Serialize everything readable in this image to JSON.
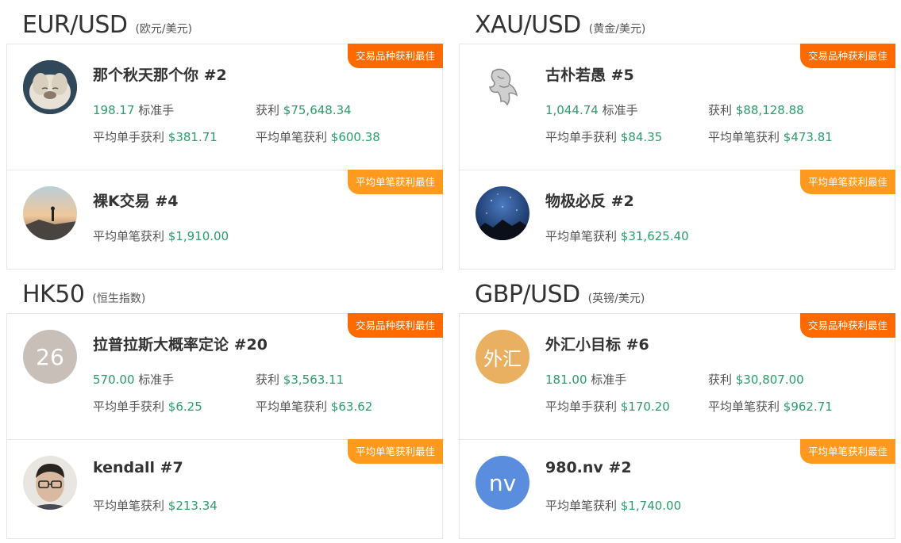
{
  "sections": [
    {
      "name": "EUR/USD",
      "sub": "(欧元/美元)",
      "top": {
        "badge": "交易品种获利最佳",
        "name": "那个秋天那个你 #2",
        "lots_val": "198.17",
        "lots_unit": "标准手",
        "profit_label": "获利",
        "profit_val": "$75,648.34",
        "avg_lot_label": "平均单手获利",
        "avg_lot_val": "$381.71",
        "avg_trade_label": "平均单笔获利",
        "avg_trade_val": "$600.38"
      },
      "bottom": {
        "badge": "平均单笔获利最佳",
        "name": "裸K交易 #4",
        "avg_trade_label": "平均单笔获利",
        "avg_trade_val": "$1,910.00"
      }
    },
    {
      "name": "XAU/USD",
      "sub": "(黄金/美元)",
      "top": {
        "badge": "交易品种获利最佳",
        "name": "古朴若愚 #5",
        "lots_val": "1,044.74",
        "lots_unit": "标准手",
        "profit_label": "获利",
        "profit_val": "$88,128.88",
        "avg_lot_label": "平均单手获利",
        "avg_lot_val": "$84.35",
        "avg_trade_label": "平均单笔获利",
        "avg_trade_val": "$473.81"
      },
      "bottom": {
        "badge": "平均单笔获利最佳",
        "name": "物极必反 #2",
        "avg_trade_label": "平均单笔获利",
        "avg_trade_val": "$31,625.40"
      }
    },
    {
      "name": "HK50",
      "sub": "(恒生指数)",
      "top": {
        "badge": "交易品种获利最佳",
        "name": "拉普拉斯大概率定论 #20",
        "avatar_text": "26",
        "lots_val": "570.00",
        "lots_unit": "标准手",
        "profit_label": "获利",
        "profit_val": "$3,563.11",
        "avg_lot_label": "平均单手获利",
        "avg_lot_val": "$6.25",
        "avg_trade_label": "平均单笔获利",
        "avg_trade_val": "$63.62"
      },
      "bottom": {
        "badge": "平均单笔获利最佳",
        "name": "kendall #7",
        "avg_trade_label": "平均单笔获利",
        "avg_trade_val": "$213.34"
      }
    },
    {
      "name": "GBP/USD",
      "sub": "(英镑/美元)",
      "top": {
        "badge": "交易品种获利最佳",
        "name": "外汇小目标 #6",
        "avatar_text": "外汇",
        "lots_val": "181.00",
        "lots_unit": "标准手",
        "profit_label": "获利",
        "profit_val": "$30,807.00",
        "avg_lot_label": "平均单手获利",
        "avg_lot_val": "$170.20",
        "avg_trade_label": "平均单笔获利",
        "avg_trade_val": "$962.71"
      },
      "bottom": {
        "badge": "平均单笔获利最佳",
        "name": "980.nv #2",
        "avatar_text": "nv",
        "avg_trade_label": "平均单笔获利",
        "avg_trade_val": "$1,740.00"
      }
    }
  ],
  "colors": {
    "accent_green": "#2a9d6a",
    "badge_orange": "#ff6a00",
    "badge_amber": "#ff9a1f",
    "avatar_26": "#c9bfb9",
    "avatar_waihui": "#e8b060",
    "avatar_nv": "#5b8ddf"
  }
}
